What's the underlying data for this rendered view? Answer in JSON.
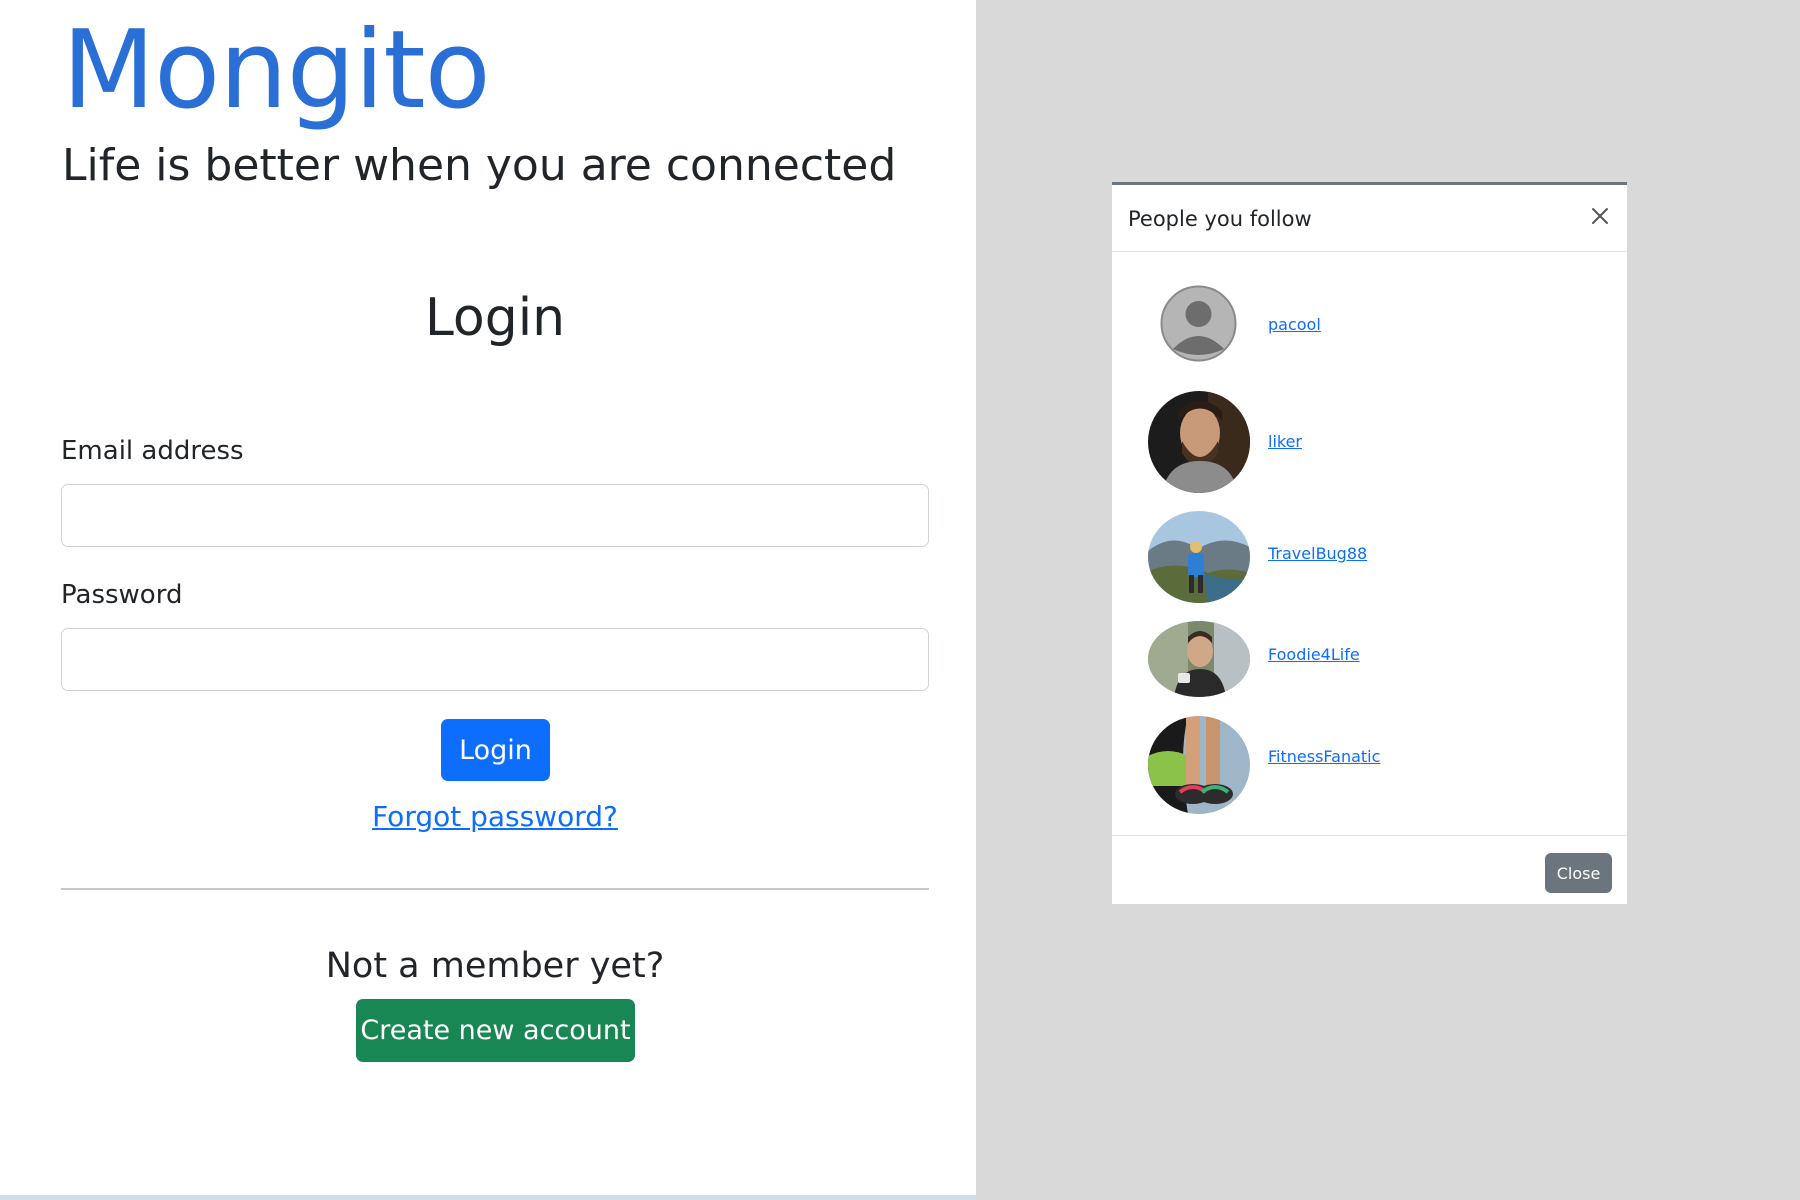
{
  "brand": {
    "name": "Mongito",
    "tagline": "Life is better when you are connected",
    "color": "#2a6fd6"
  },
  "login": {
    "heading": "Login",
    "email_label": "Email address",
    "email_value": "",
    "password_label": "Password",
    "password_value": "",
    "submit_label": "Login",
    "forgot_label": "Forgot password?",
    "not_member_text": "Not a member yet?",
    "create_label": "Create new account"
  },
  "modal": {
    "title": "People you follow",
    "close_label": "Close",
    "people": [
      {
        "name": "pacool",
        "avatar": "default-avatar-icon"
      },
      {
        "name": "liker",
        "avatar": "photo-bearded-man"
      },
      {
        "name": "TravelBug88",
        "avatar": "photo-hiker-mountains"
      },
      {
        "name": "Foodie4Life",
        "avatar": "photo-man-smiling"
      },
      {
        "name": "FitnessFanatic",
        "avatar": "photo-sneakers-lake"
      }
    ]
  },
  "colors": {
    "primary": "#0d6efd",
    "success": "#198754",
    "secondary": "#6c757d",
    "backdrop": "#d9d9d9"
  }
}
